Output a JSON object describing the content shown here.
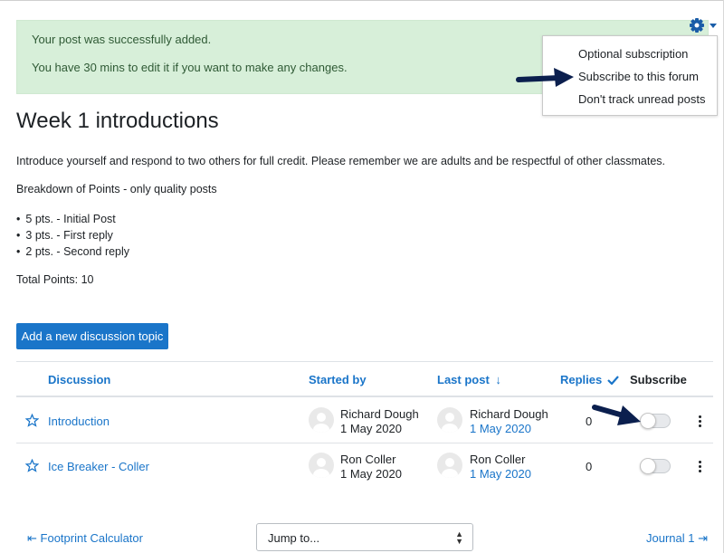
{
  "alert": {
    "line1": "Your post was successfully added.",
    "line2": "You have 30 mins to edit it if you want to make any changes."
  },
  "settings_menu": {
    "icon": "gear-icon",
    "items": [
      {
        "label": "Optional subscription"
      },
      {
        "label": "Subscribe to this forum"
      },
      {
        "label": "Don't track unread posts"
      }
    ]
  },
  "forum": {
    "title": "Week 1 introductions",
    "intro": "Introduce yourself and respond to two others for full credit. Please remember we are adults and be respectful of other classmates.",
    "breakdown_heading": "Breakdown of Points - only quality posts",
    "points": [
      "5 pts. - Initial Post",
      "3 pts. - First reply",
      "2 pts. - Second reply"
    ],
    "total": "Total Points: 10"
  },
  "add_topic_button": "Add a new discussion topic",
  "table": {
    "headers": {
      "discussion": "Discussion",
      "started_by": "Started by",
      "last_post": "Last post",
      "replies": "Replies",
      "subscribe": "Subscribe"
    },
    "rows": [
      {
        "title": "Introduction",
        "starter": "Richard Dough",
        "start_date": "1 May 2020",
        "last_poster": "Richard Dough",
        "last_date": "1 May 2020",
        "replies": "0",
        "subscribed": false
      },
      {
        "title": "Ice Breaker - Coller",
        "starter": "Ron Coller",
        "start_date": "1 May 2020",
        "last_poster": "Ron Coller",
        "last_date": "1 May 2020",
        "replies": "0",
        "subscribed": false
      }
    ]
  },
  "footer_nav": {
    "prev": "Footprint Calculator",
    "jump_placeholder": "Jump to...",
    "next": "Journal 1"
  },
  "colors": {
    "accent": "#1a75c9",
    "success_bg": "#d7efd9",
    "annotation_arrow": "#0b1f4e"
  }
}
